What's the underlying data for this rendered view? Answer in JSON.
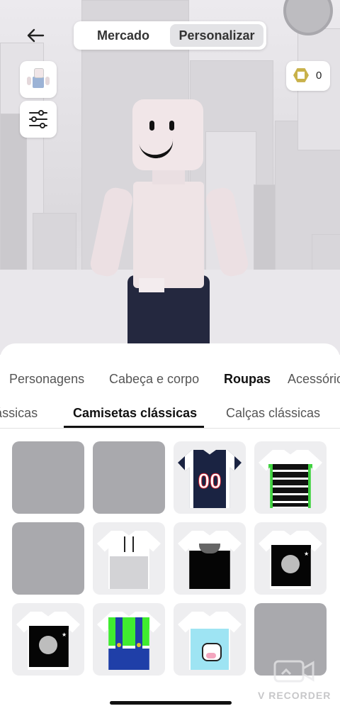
{
  "top_nav": {
    "segment_left_label": "Mercado",
    "segment_right_label": "Personalizar",
    "robux_count": "0"
  },
  "categories": [
    {
      "label": "Personagens",
      "active": false
    },
    {
      "label": "Cabeça e corpo",
      "active": false
    },
    {
      "label": "Roupas",
      "active": true
    },
    {
      "label": "Acessórios",
      "active": false
    }
  ],
  "subcategories": [
    {
      "label": "Jaquetas clássicas",
      "active": false
    },
    {
      "label": "Camisetas clássicas",
      "active": true
    },
    {
      "label": "Calças clássicas",
      "active": false
    }
  ],
  "items": [
    {
      "kind": "empty"
    },
    {
      "kind": "empty"
    },
    {
      "kind": "jersey",
      "number": "00"
    },
    {
      "kind": "stripes"
    },
    {
      "kind": "empty"
    },
    {
      "kind": "hoodie-white"
    },
    {
      "kind": "hoodie-black"
    },
    {
      "kind": "cat-black"
    },
    {
      "kind": "cat-black"
    },
    {
      "kind": "overalls"
    },
    {
      "kind": "cow-top"
    },
    {
      "kind": "empty"
    }
  ],
  "watermark": "V RECORDER"
}
